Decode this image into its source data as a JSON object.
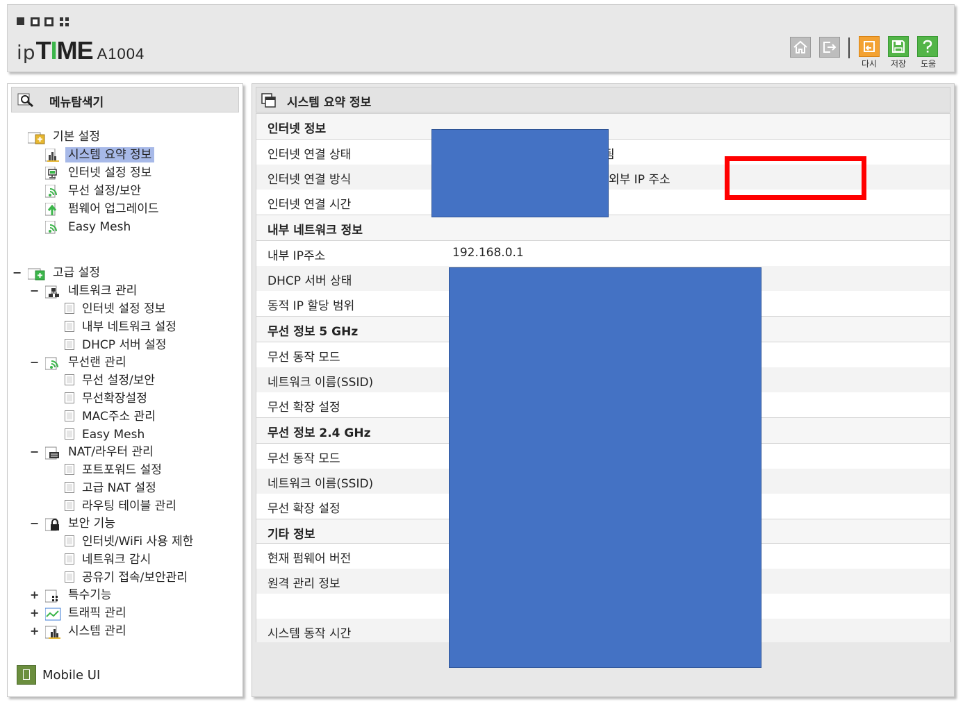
{
  "header": {
    "brand_prefix": "ip",
    "brand_main_a": "T",
    "brand_main_i": "I",
    "brand_main_b": "ME",
    "model": "A1004",
    "toolbar": {
      "home_icon": "home-icon",
      "logout_icon": "logout-icon",
      "reload_label": "다시",
      "save_label": "저장",
      "help_label": "도움"
    }
  },
  "sidebar": {
    "title": "메뉴탐색기",
    "basic": {
      "label": "기본 설정",
      "items": [
        "시스템 요약 정보",
        "인터넷 설정 정보",
        "무선 설정/보안",
        "펌웨어 업그레이드",
        "Easy Mesh"
      ]
    },
    "advanced": {
      "label": "고급 설정",
      "network": {
        "label": "네트워크 관리",
        "items": [
          "인터넷 설정 정보",
          "내부 네트워크 설정",
          "DHCP 서버 설정"
        ]
      },
      "wireless": {
        "label": "무선랜 관리",
        "items": [
          "무선 설정/보안",
          "무선확장설정",
          "MAC주소 관리",
          "Easy Mesh"
        ]
      },
      "nat": {
        "label": "NAT/라우터 관리",
        "items": [
          "포트포워드 설정",
          "고급 NAT 설정",
          "라우팅 테이블 관리"
        ]
      },
      "security": {
        "label": "보안 기능",
        "items": [
          "인터넷/WiFi 사용 제한",
          "네트워크 감시",
          "공유기 접속/보안관리"
        ]
      },
      "special": {
        "label": "특수기능"
      },
      "traffic": {
        "label": "트래픽 관리"
      },
      "system": {
        "label": "시스템 관리"
      }
    },
    "fold_minus": "−",
    "fold_plus": "+",
    "mobile_ui": "Mobile UI"
  },
  "main": {
    "title": "시스템 요약 정보",
    "rows": {
      "internet_section": "인터넷 정보",
      "internet_status": "인터넷 연결 상태",
      "internet_status_tail": "됨",
      "internet_method": "인터넷 연결 방식",
      "external_ip_label": "외부 IP 주소",
      "internet_time": "인터넷 연결 시간",
      "lan_section": "내부 네트워크 정보",
      "lan_ip": "내부 IP주소",
      "lan_ip_value": "192.168.0.1",
      "dhcp_status": "DHCP 서버 상태",
      "dynamic_range": "동적 IP 할당 범위",
      "w5_section": "무선 정보 5 GHz",
      "w5_mode": "무선 동작 모드",
      "w5_ssid": "네트워크 이름(SSID)",
      "w5_ext": "무선 확장 설정",
      "w24_section": "무선 정보 2.4 GHz",
      "w24_mode": "무선 동작 모드",
      "w24_ssid": "네트워크 이름(SSID)",
      "w24_ext": "무선 확장 설정",
      "etc_section": "기타 정보",
      "firmware": "현재 펌웨어 버전",
      "remote": "원격 관리 정보",
      "uptime": "시스템 동작 시간"
    }
  },
  "colors": {
    "redaction": "#4472c4",
    "highlight_box": "#ff0000",
    "selected_item": "#a7b9e8",
    "brand_green": "#3bb54a"
  }
}
